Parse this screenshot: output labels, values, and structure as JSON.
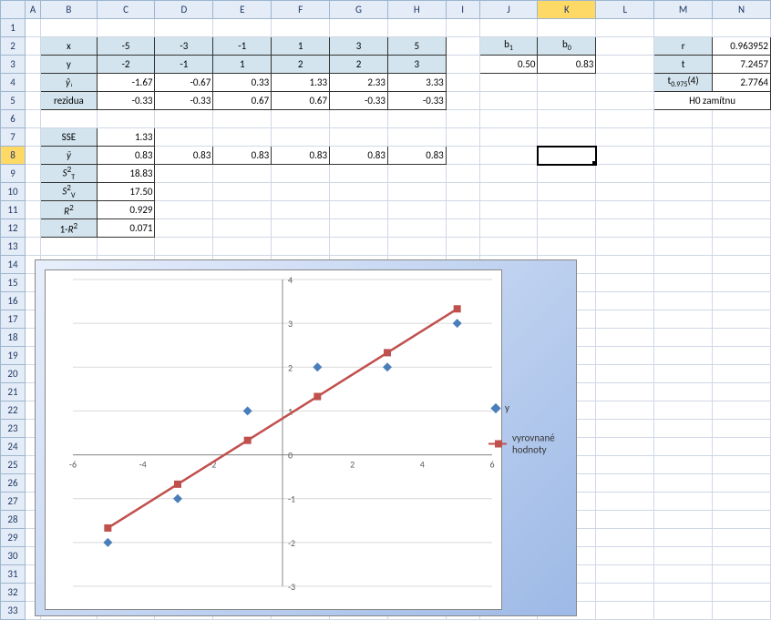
{
  "columns": [
    "A",
    "B",
    "C",
    "D",
    "E",
    "F",
    "G",
    "H",
    "I",
    "J",
    "K",
    "L",
    "M",
    "N"
  ],
  "rows": [
    "1",
    "2",
    "3",
    "4",
    "5",
    "6",
    "7",
    "8",
    "9",
    "10",
    "11",
    "12",
    "13",
    "14",
    "15",
    "16",
    "17",
    "18",
    "19",
    "20",
    "21",
    "22",
    "23",
    "24",
    "25",
    "26",
    "27",
    "28",
    "29",
    "30",
    "31",
    "32",
    "33"
  ],
  "active_cell": "K8",
  "table1": {
    "headers": [
      "x",
      "y",
      "ŷᵢ",
      "rezidua"
    ],
    "x": [
      "-5",
      "-3",
      "-1",
      "1",
      "3",
      "5"
    ],
    "y": [
      "-2",
      "-1",
      "1",
      "2",
      "2",
      "3"
    ],
    "yhat": [
      "-1.67",
      "-0.67",
      "0.33",
      "1.33",
      "2.33",
      "3.33"
    ],
    "res": [
      "-0.33",
      "-0.33",
      "0.67",
      "0.67",
      "-0.33",
      "-0.33"
    ]
  },
  "coeffs": {
    "hdr_b1": "b₁",
    "hdr_b0": "b₀",
    "b1": "0.50",
    "b0": "0.83"
  },
  "stats": {
    "r_lbl": "r",
    "r": "0.963952",
    "t_lbl": "t",
    "t": "7.2457",
    "tcrit_lbl": "t₀.₉₇₅(4)",
    "tcrit": "2.7764",
    "decision": "H0 zamítnu"
  },
  "block": {
    "sse_lbl": "SSE",
    "sse": "1.33",
    "ybar_lbl": "ȳ",
    "ybar": [
      "0.83",
      "0.83",
      "0.83",
      "0.83",
      "0.83",
      "0.83"
    ],
    "sT_lbl": "S²_T",
    "sT": "18.83",
    "sV_lbl": "S²_V",
    "sV": "17.50",
    "r2_lbl": "R²",
    "r2": "0.929",
    "oneMr2_lbl": "1-R²",
    "oneMr2": "0.071"
  },
  "chart_data": {
    "type": "scatter+line",
    "x": [
      -5,
      -3,
      -1,
      1,
      3,
      5
    ],
    "series": [
      {
        "name": "y",
        "type": "scatter",
        "values": [
          -2,
          -1,
          1,
          2,
          2,
          3
        ]
      },
      {
        "name": "vyrovnané hodnoty",
        "type": "line",
        "values": [
          -1.67,
          -0.67,
          0.33,
          1.33,
          2.33,
          3.33
        ]
      }
    ],
    "xlim": [
      -6,
      6
    ],
    "ylim": [
      -3,
      4
    ],
    "xticks": [
      -6,
      -4,
      -2,
      0,
      2,
      4,
      6
    ],
    "yticks": [
      -3,
      -2,
      -1,
      0,
      1,
      2,
      3,
      4
    ],
    "legend": [
      "y",
      "vyrovnané hodnoty"
    ]
  }
}
